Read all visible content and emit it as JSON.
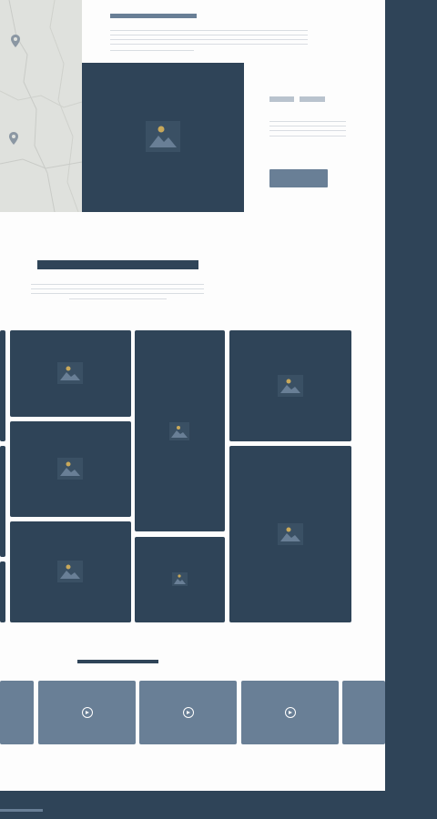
{
  "colors": {
    "placeholder_dark": "#2f4458",
    "placeholder_mid": "#697f96",
    "image_sun": "#c8a85a",
    "text_line": "#d9dde2",
    "map_bg": "#dfe1dd",
    "map_pin": "#8b97a3"
  },
  "icons": {
    "image_placeholder": "image-icon",
    "map_pin": "map-pin-icon",
    "play": "play-circle-icon"
  },
  "map": {
    "pins": 2
  },
  "feature": {
    "tags": 2,
    "button_label": ""
  },
  "gallery": {
    "tiles": 9
  },
  "videos": {
    "count": 5
  }
}
